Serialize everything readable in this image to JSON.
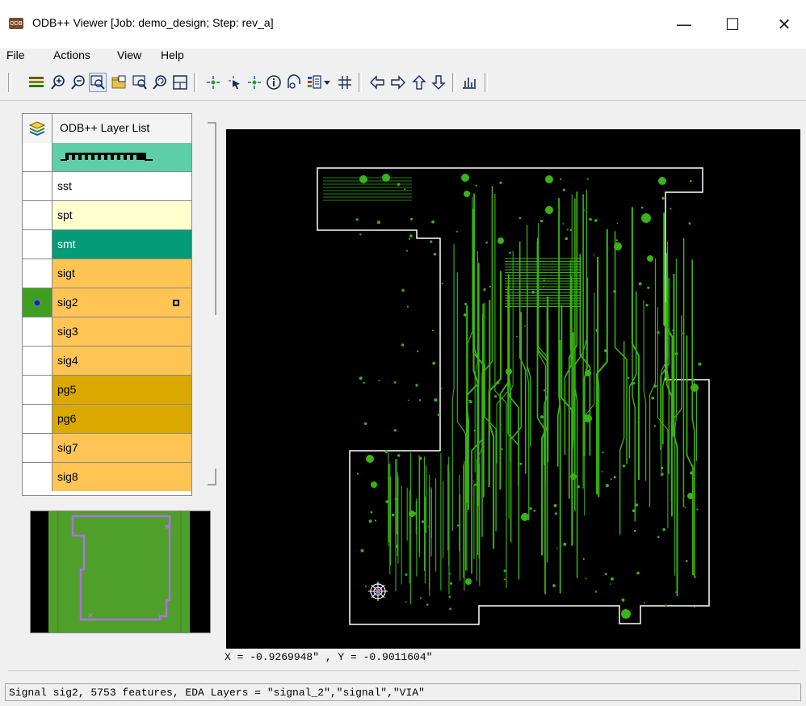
{
  "window": {
    "title": "ODB++ Viewer [Job: demo_design; Step: rev_a]",
    "app_icon_text": "ODB",
    "minimize_glyph": "—",
    "maximize_glyph": "☐",
    "close_glyph": "✕"
  },
  "menu": [
    "File",
    "Actions",
    "View",
    "Help"
  ],
  "toolbar": {
    "icons": [
      "layers-icon",
      "zoom-in-icon",
      "zoom-out-icon",
      "zoom-window-icon",
      "open-folder-icon",
      "zoom-fit-icon",
      "zoom-previous-icon",
      "grid-frame-icon",
      "select-icon",
      "pointer-select-icon",
      "net-select-icon",
      "info-icon",
      "measure-icon",
      "display-options-icon",
      "dropdown-arrow-icon",
      "grid-icon",
      "pan-left-icon",
      "pan-right-icon",
      "pan-up-icon",
      "pan-down-icon",
      "histogram-icon"
    ]
  },
  "layer_list": {
    "header": "ODB++ Layer List",
    "rows": [
      {
        "name": "",
        "color": "#5ecfa9",
        "component_strip": true
      },
      {
        "name": "sst",
        "color": "#ffffff"
      },
      {
        "name": "spt",
        "color": "#ffffd0"
      },
      {
        "name": "smt",
        "color": "#039b78"
      },
      {
        "name": "sigt",
        "color": "#ffc454"
      },
      {
        "name": "sig2",
        "color": "#ffc454",
        "active": true,
        "active_color": "#3e9e1e"
      },
      {
        "name": "sig3",
        "color": "#ffc454"
      },
      {
        "name": "sig4",
        "color": "#ffc454"
      },
      {
        "name": "pg5",
        "color": "#dba800"
      },
      {
        "name": "pg6",
        "color": "#dba800"
      },
      {
        "name": "sig7",
        "color": "#ffc454"
      },
      {
        "name": "sig8",
        "color": "#ffc454"
      }
    ]
  },
  "colors": {
    "trace": "#39b315",
    "board_outline": "#ffffff",
    "canvas_bg": "#000000",
    "preview_board": "#4fa02a",
    "preview_outline": "#b070e0"
  },
  "coordinates": "X = -0.9269948\" , Y = -0.9011604\"",
  "status": "Signal sig2, 5753 features, EDA Layers = \"signal_2\",\"signal\",\"VIA\""
}
